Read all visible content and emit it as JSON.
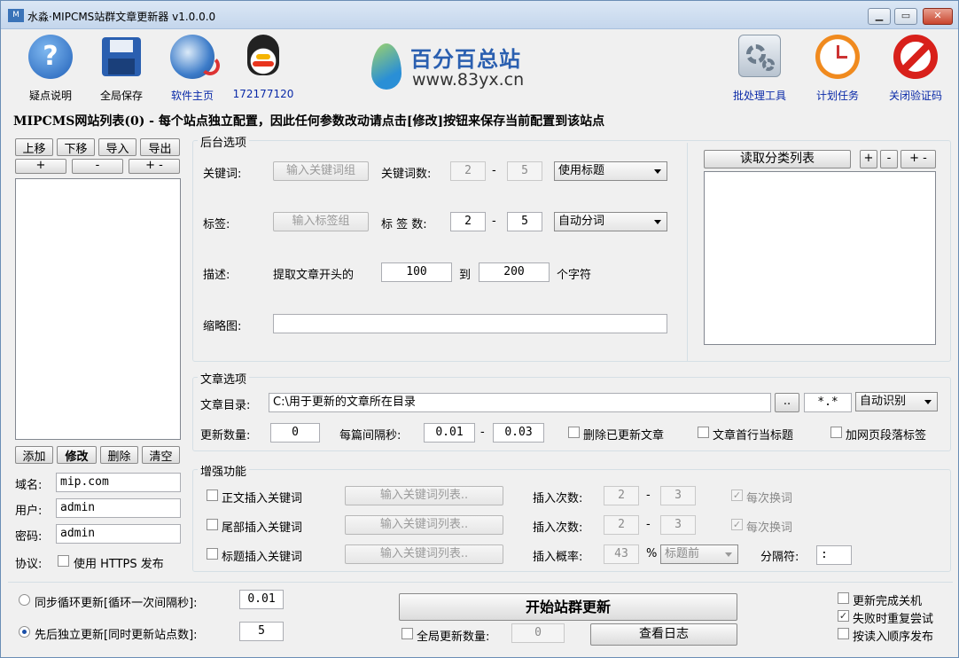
{
  "window": {
    "title": "水淼·MIPCMS站群文章更新器 v1.0.0.0",
    "icon_text": "M"
  },
  "toolbar": {
    "faq": "疑点说明",
    "save": "全局保存",
    "home": "软件主页",
    "qq": "172177120",
    "logo_name": "百分百总站",
    "logo_url": "www.83yx.cn",
    "batch": "批处理工具",
    "schedule": "计划任务",
    "captcha": "关闭验证码"
  },
  "heading": "MIPCMS网站列表(0) - 每个站点独立配置，因此任何参数改动请点击[修改]按钮来保存当前配置到该站点",
  "sitelist": {
    "up": "上移",
    "down": "下移",
    "import": "导入",
    "export": "导出",
    "plus": "+",
    "minus": "-",
    "plusminus": "+ -",
    "add": "添加",
    "modify": "修改",
    "delete": "删除",
    "clear": "清空",
    "domain_label": "域名:",
    "domain_value": "mip.com",
    "user_label": "用户:",
    "user_value": "admin",
    "pass_label": "密码:",
    "pass_value": "admin",
    "protocol_label": "协议:",
    "https_label": "使用 HTTPS 发布"
  },
  "backend": {
    "title": "后台选项",
    "keyword_label": "关键词:",
    "keyword_btn": "输入关键词组",
    "keyword_count_label": "关键词数:",
    "keyword_min": "2",
    "keyword_max": "5",
    "keyword_mode": "使用标题",
    "tag_label": "标签:",
    "tag_btn": "输入标签组",
    "tag_count_label": "标 签 数:",
    "tag_min": "2",
    "tag_max": "5",
    "tag_mode": "自动分词",
    "dash": "-",
    "desc_label": "描述:",
    "desc_prefix": "提取文章开头的",
    "desc_from": "100",
    "desc_to_label": "到",
    "desc_to": "200",
    "desc_suffix": "个字符",
    "thumb_label": "缩略图:",
    "read_category": "读取分类列表",
    "cat_plus": "+",
    "cat_minus": "-",
    "cat_plusminus": "+ -"
  },
  "article": {
    "title": "文章选项",
    "dir_label": "文章目录:",
    "dir_value": "C:\\用于更新的文章所在目录",
    "browse": "..",
    "ext": "*.*",
    "encoding": "自动识别",
    "count_label": "更新数量:",
    "count_value": "0",
    "interval_label": "每篇间隔秒:",
    "interval_min": "0.01",
    "interval_max": "0.03",
    "dash": "-",
    "delete_updated": "删除已更新文章",
    "first_line_title": "文章首行当标题",
    "add_para_tag": "加网页段落标签"
  },
  "enhance": {
    "title": "增强功能",
    "body_kw": "正文插入关键词",
    "tail_kw": "尾部插入关键词",
    "title_kw": "标题插入关键词",
    "kw_list_btn": "输入关键词列表..",
    "insert_count_label": "插入次数:",
    "count_min": "2",
    "count_max": "3",
    "dash": "-",
    "each_swap": "每次换词",
    "insert_prob_label": "插入概率:",
    "prob_value": "43",
    "percent": "%",
    "title_pos": "标题前",
    "separator_label": "分隔符:",
    "separator_value": ":"
  },
  "bottom": {
    "sync_label": "同步循环更新[循环一次间隔秒]:",
    "sync_value": "0.01",
    "seq_label": "先后独立更新[同时更新站点数]:",
    "seq_value": "5",
    "start": "开始站群更新",
    "global_count_label": "全局更新数量:",
    "global_count_value": "0",
    "log": "查看日志",
    "shutdown": "更新完成关机",
    "retry": "失败时重复尝试",
    "order": "按读入顺序发布"
  }
}
